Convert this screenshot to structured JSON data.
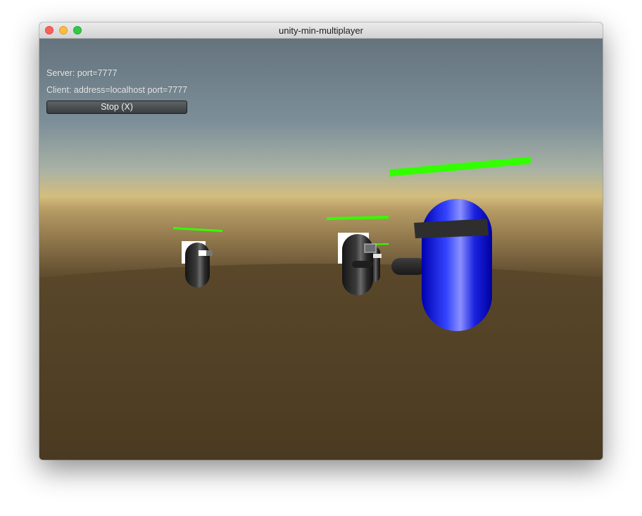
{
  "window": {
    "title": "unity-min-multiplayer"
  },
  "hud": {
    "server_status": "Server: port=7777",
    "client_status": "Client: address=localhost port=7777",
    "stop_button_label": "Stop (X)"
  },
  "scene": {
    "players": [
      {
        "body_color": "#0000ff",
        "health_bar_color": "#33ff00",
        "health": 1.0
      },
      {
        "body_color": "#2a2a2a",
        "health_bar_color": "#33ff00",
        "health": 1.0
      },
      {
        "body_color": "#2a2a2a",
        "health_bar_color": "#33ff00",
        "health": 1.0
      },
      {
        "body_color": "#2a2a2a",
        "health_bar_color": "#33ff00",
        "health": 1.0
      }
    ],
    "sky_colors": [
      "#65737d",
      "#8a9fa8",
      "#d9bf78"
    ],
    "ground_color": "#4a3a22"
  }
}
